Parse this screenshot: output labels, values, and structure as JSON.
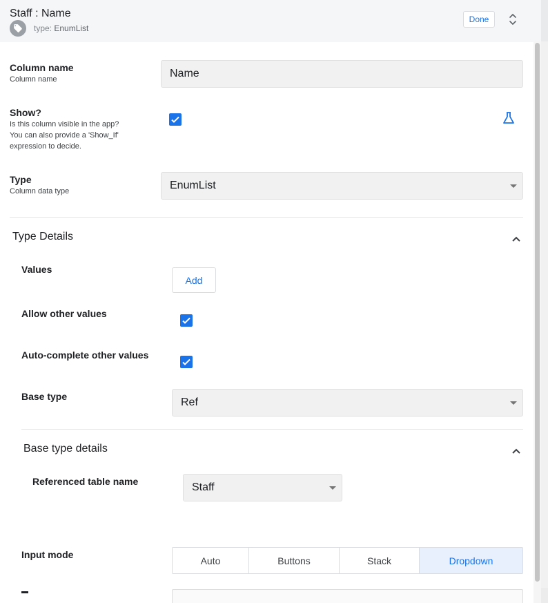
{
  "header": {
    "title": "Staff : Name",
    "type_prefix": "type:",
    "type_value": "EnumList",
    "done_label": "Done",
    "tag_icon": "tag-icon",
    "expand_icon": "unfold-icon"
  },
  "column_name": {
    "label": "Column name",
    "hint": "Column name",
    "value": "Name"
  },
  "show": {
    "label": "Show?",
    "hint_lines": [
      "Is this column visible in the app?",
      "You can also provide a 'Show_If'",
      "expression to decide."
    ],
    "checked": true,
    "expression_icon": "flask-icon"
  },
  "type": {
    "label": "Type",
    "hint": "Column data type",
    "value": "EnumList"
  },
  "type_details": {
    "title": "Type Details",
    "values_label": "Values",
    "add_label": "Add",
    "allow_other_label": "Allow other values",
    "allow_other_checked": true,
    "autocomplete_label": "Auto-complete other values",
    "autocomplete_checked": true,
    "base_type_label": "Base type",
    "base_type_value": "Ref"
  },
  "base_type_details": {
    "title": "Base type details",
    "ref_table_label": "Referenced table name",
    "ref_table_value": "Staff"
  },
  "input_mode": {
    "label": "Input mode",
    "options": [
      "Auto",
      "Buttons",
      "Stack",
      "Dropdown"
    ],
    "selected": "Dropdown"
  },
  "colors": {
    "accent": "#1a73e8",
    "checkbox": "#1a73e8",
    "selected_segment_bg": "#e8f0fe"
  }
}
